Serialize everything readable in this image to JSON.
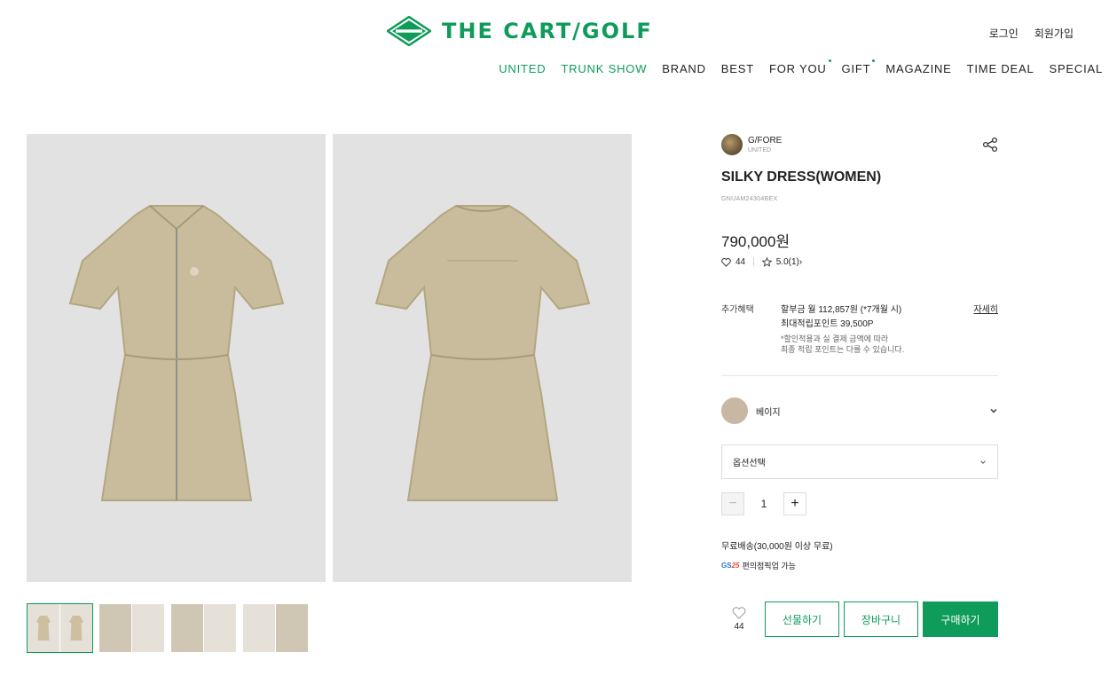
{
  "header": {
    "logo_text": "THE CART/GOLF",
    "logo_mark_text": "THECART GOLF",
    "login": "로그인",
    "signup": "회원가입",
    "nav": [
      {
        "label": "UNITED",
        "green": true,
        "dot": false
      },
      {
        "label": "TRUNK SHOW",
        "green": true,
        "dot": false
      },
      {
        "label": "BRAND",
        "green": false,
        "dot": false
      },
      {
        "label": "BEST",
        "green": false,
        "dot": false
      },
      {
        "label": "FOR YOU",
        "green": false,
        "dot": true
      },
      {
        "label": "GIFT",
        "green": false,
        "dot": true
      },
      {
        "label": "MAGAZINE",
        "green": false,
        "dot": false
      },
      {
        "label": "TIME DEAL",
        "green": false,
        "dot": false
      },
      {
        "label": "SPECIAL",
        "green": false,
        "dot": false
      }
    ]
  },
  "product": {
    "brand": "G/FORE",
    "brand_sub": "UNITED",
    "title": "SILKY DRESS(WOMEN)",
    "code": "GNUAM24304BEX",
    "price": "790,000원",
    "likes": "44",
    "rating": "5.0(1)",
    "rating_arrow": "›"
  },
  "benefit": {
    "label": "추가혜택",
    "installment": "할부금 월 112,857원 (*7개월 시)",
    "points": "최대적립포인트 39,500P",
    "note1": "*할인적용과 실 결제 금액에 따라",
    "note2": "최종 적립 포인트는 다를 수 있습니다.",
    "more": "자세히"
  },
  "options": {
    "color_label": "베이지",
    "select_placeholder": "옵션선택",
    "quantity": "1",
    "minus": "−",
    "plus": "+"
  },
  "shipping": {
    "text": "무료배송(30,000원 이상 무료)",
    "pickup_logo_gs": "GS",
    "pickup_logo_25": "25",
    "pickup": "편의점픽업 가능"
  },
  "actions": {
    "wish_count": "44",
    "gift": "선물하기",
    "cart": "장바구니",
    "buy": "구매하기"
  },
  "colors": {
    "brand_green": "#0f9b5a",
    "swatch_beige": "#c8b7a3"
  }
}
